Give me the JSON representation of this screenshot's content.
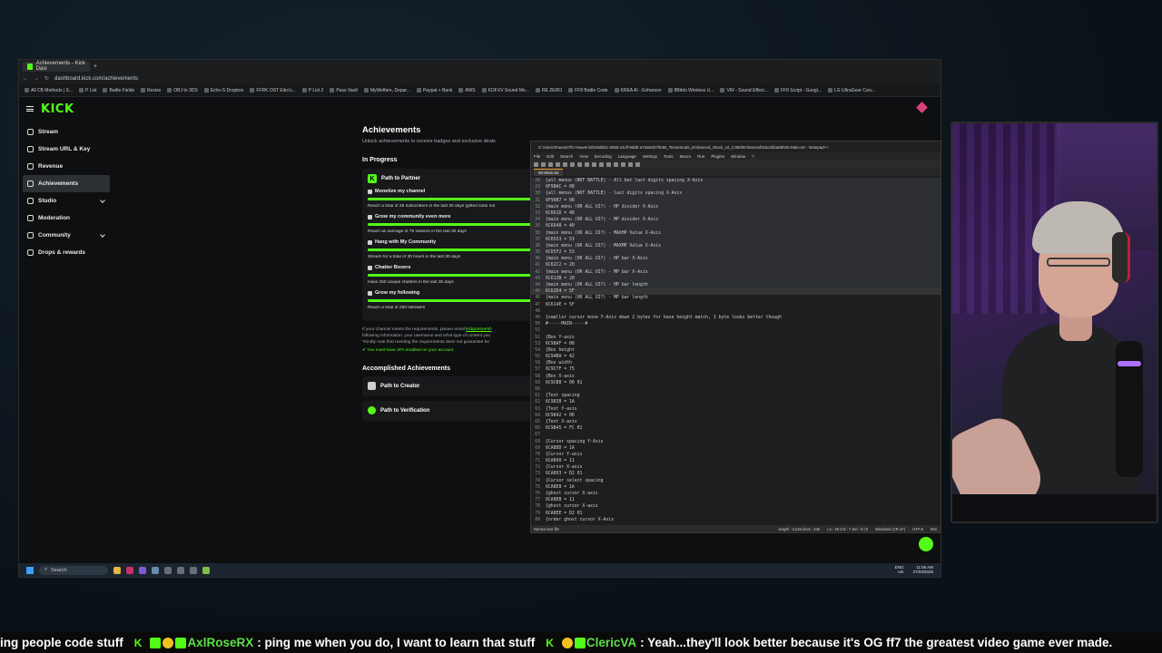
{
  "browser": {
    "tab_title": "Achievements - Kick Dasi",
    "url": "dashboard.kick.com/achievements",
    "bookmarks": [
      "All CB Methods | S...",
      "P List",
      "Battle Fields",
      "Resize",
      "OBJ to 3DS",
      "Echo-S Dropbox",
      "FFRK OST Eiko's...",
      "P List 2",
      "Pass Vault",
      "MyWelfare, Depar...",
      "Paypal + Bank",
      "AWS",
      "KOFXV Sound Mo...",
      "RE ZERO",
      "FF8 Battle Code",
      "KREA AI - Enhancer",
      "8Bitdo Wireless U...",
      "VIR - Sound Effect...",
      "FF8 Script - Googl...",
      "LG UltraGear Curv..."
    ]
  },
  "kick": {
    "logo": "KICK",
    "sidebar": [
      {
        "label": "Stream",
        "active": false,
        "expand": false
      },
      {
        "label": "Stream URL & Key",
        "active": false,
        "expand": false
      },
      {
        "label": "Revenue",
        "active": false,
        "expand": false
      },
      {
        "label": "Achievements",
        "active": true,
        "expand": false
      },
      {
        "label": "Studio",
        "active": false,
        "expand": true
      },
      {
        "label": "Moderation",
        "active": false,
        "expand": false
      },
      {
        "label": "Community",
        "active": false,
        "expand": true
      },
      {
        "label": "Drops & rewards",
        "active": false,
        "expand": false
      }
    ],
    "title": "Achievements",
    "subtitle": "Unlock achievements to receive badges and exclusive deals",
    "in_progress_title": "In Progress",
    "path_title": "Path to Partner",
    "tasks": [
      {
        "name": "Monetize my channel",
        "desc": "Reach a total of 25 subscribers in the last 30 days (gifted subs not"
      },
      {
        "name": "Grow my community even more",
        "desc": "Reach an average of 75 viewers in the last 30 days"
      },
      {
        "name": "Hang with My Community",
        "desc": "Stream for a total of 30 hours in the last 30 days"
      },
      {
        "name": "Chatter Boxers",
        "desc": "Have 250 unique chatters in the last 30 days"
      },
      {
        "name": "Grow my following",
        "desc": "Reach a total of 250 followers"
      }
    ],
    "note_1": "If your channel meets the requirements, please email",
    "note_link": "kickpartnersh",
    "note_2": "following information: your username and what type of content you",
    "note_3": "*Kindly note that meeting the requirements does not guarantee be",
    "twofa": "You must have 2FA enabled on your account",
    "accomplished_title": "Accomplished Achievements",
    "accomplished": [
      "Path to Creator",
      "Path to Verification"
    ]
  },
  "notepad": {
    "title": "C:\\Users\\Fauna\\7th Heaven\\2b49d831-6556-41df-9ddb-a7a6e937f54B_Tsunemods_Enhanced_Stock_UI_2.960\\Enhanced\\Stock\\battle\\00-Main.txt - Notepad++",
    "menu": [
      "File",
      "Edit",
      "Search",
      "View",
      "Encoding",
      "Language",
      "Settings",
      "Tools",
      "Macro",
      "Run",
      "Plugins",
      "Window",
      "?"
    ],
    "tab": "00-Main.txt",
    "lines": [
      {
        "n": "28",
        "t": "{all menus (NOT BATTLE) - All but last digits spacing X-Axis",
        "s": "sel"
      },
      {
        "n": "29",
        "t": "6F98AC = 08",
        "s": "sel"
      },
      {
        "n": "30",
        "t": "{all menus (NOT BATTLE) - last digits spacing X-Axis",
        "s": "sel"
      },
      {
        "n": "31",
        "t": "6F96B7 = 08",
        "s": "sel"
      },
      {
        "n": "32",
        "t": "{main menu (OR ALL UI?) - HP divider X-Axis",
        "s": "sel"
      },
      {
        "n": "33",
        "t": "6C661D = 48",
        "s": "sel"
      },
      {
        "n": "34",
        "t": "{main menu (OR ALL UI?) - MP divider X-Axis",
        "s": "sel"
      },
      {
        "n": "35",
        "t": "6C6648 = 40",
        "s": "sel"
      },
      {
        "n": "36",
        "t": "{main menu (OR ALL UI?) - MAXHP Value X-Axis",
        "s": "sel"
      },
      {
        "n": "37",
        "t": "6C6553 = 53",
        "s": "sel"
      },
      {
        "n": "38",
        "t": "{main menu (OR ALL UI?) - MAXMP Value X-Axis",
        "s": "sel"
      },
      {
        "n": "39",
        "t": "6C65F2 = 53",
        "s": "sel"
      },
      {
        "n": "40",
        "t": "{main menu (OR ALL UI?) - HP bar X-Axis",
        "s": "sel"
      },
      {
        "n": "41",
        "t": "6C62C2 = 20",
        "s": "sel"
      },
      {
        "n": "42",
        "t": "{main menu (OR ALL UI?) - MP bar X-Axis",
        "s": "sel"
      },
      {
        "n": "43",
        "t": "6C613B = 20",
        "s": "sel"
      },
      {
        "n": "44",
        "t": "{main menu (OR ALL UI?) - HP bar length",
        "s": "sel"
      },
      {
        "n": "45",
        "t": "6C62D4 = 5F",
        "s": "cur"
      },
      {
        "n": "46",
        "t": "{main menu (OR ALL UI?) - MP bar length",
        "s": ""
      },
      {
        "n": "47",
        "t": "6C614E = 5F",
        "s": ""
      },
      {
        "n": "48",
        "t": "",
        "s": ""
      },
      {
        "n": "49",
        "t": "{smaller cursor move Y-Axis down 2 bytes for base height match, 1 byte looks better though",
        "s": ""
      },
      {
        "n": "50",
        "t": "#-----MAIN-----#",
        "s": ""
      },
      {
        "n": "51",
        "t": "",
        "s": ""
      },
      {
        "n": "52",
        "t": "{Box Y-axis",
        "s": ""
      },
      {
        "n": "53",
        "t": "6C98AF = 00",
        "s": ""
      },
      {
        "n": "54",
        "t": "{Box height",
        "s": ""
      },
      {
        "n": "55",
        "t": "6C94BA = 42",
        "s": ""
      },
      {
        "n": "56",
        "t": "{Box width",
        "s": ""
      },
      {
        "n": "57",
        "t": "6C9C7F = 75",
        "s": ""
      },
      {
        "n": "58",
        "t": "{Box X-axis",
        "s": ""
      },
      {
        "n": "59",
        "t": "6C9CB8 = 00 01",
        "s": ""
      },
      {
        "n": "60",
        "t": "",
        "s": ""
      },
      {
        "n": "61",
        "t": "{Text spacing",
        "s": ""
      },
      {
        "n": "62",
        "t": "6C9838 = 1A",
        "s": ""
      },
      {
        "n": "63",
        "t": "{Text Y-axis",
        "s": ""
      },
      {
        "n": "64",
        "t": "6C9842 = 0D",
        "s": ""
      },
      {
        "n": "65",
        "t": "{Text X-axis",
        "s": ""
      },
      {
        "n": "66",
        "t": "6C9845 = FC 01",
        "s": ""
      },
      {
        "n": "67",
        "t": "",
        "s": ""
      },
      {
        "n": "68",
        "t": "{Cursor spacing Y-Axis",
        "s": ""
      },
      {
        "n": "69",
        "t": "6CA88D = 1A",
        "s": ""
      },
      {
        "n": "70",
        "t": "{Cursor Y-axis",
        "s": ""
      },
      {
        "n": "71",
        "t": "6CA890 = 11",
        "s": ""
      },
      {
        "n": "72",
        "t": "{Cursor X-axis",
        "s": ""
      },
      {
        "n": "73",
        "t": "6CA893 = D2 01",
        "s": ""
      },
      {
        "n": "74",
        "t": "{Cursor select spacing",
        "s": ""
      },
      {
        "n": "75",
        "t": "6CA8E8 = 1A",
        "s": ""
      },
      {
        "n": "76",
        "t": "{ghost cursor X-axis",
        "s": ""
      },
      {
        "n": "77",
        "t": "6CA8EB = 11",
        "s": ""
      },
      {
        "n": "78",
        "t": "{ghost cursor X-axis",
        "s": ""
      },
      {
        "n": "79",
        "t": "6CA8EE = D2 01",
        "s": ""
      },
      {
        "n": "80",
        "t": "{order ghost cursor X-Axis",
        "s": ""
      }
    ],
    "status": {
      "type": "Normal text file",
      "length": "length : 3,245   lines : 240",
      "position": "Ln : 45   Col : 7   Sel : 0 | 0",
      "eol": "Windows (CR LF)",
      "encoding": "UTF-8",
      "mode": "INS"
    }
  },
  "taskbar": {
    "search": "Search",
    "lang": "ENG\nUK",
    "time": "11:55 AM",
    "date": "27/03/2026"
  },
  "ticker": {
    "prefix": "ing people code stuff",
    "user1": "AxlRoseRX",
    "msg1": ": ping me when you do, I want to learn that stuff",
    "user2": "ClericVA",
    "msg2": ": Yeah...they'll look better because it's OG ff7 the greatest video game ever made."
  }
}
